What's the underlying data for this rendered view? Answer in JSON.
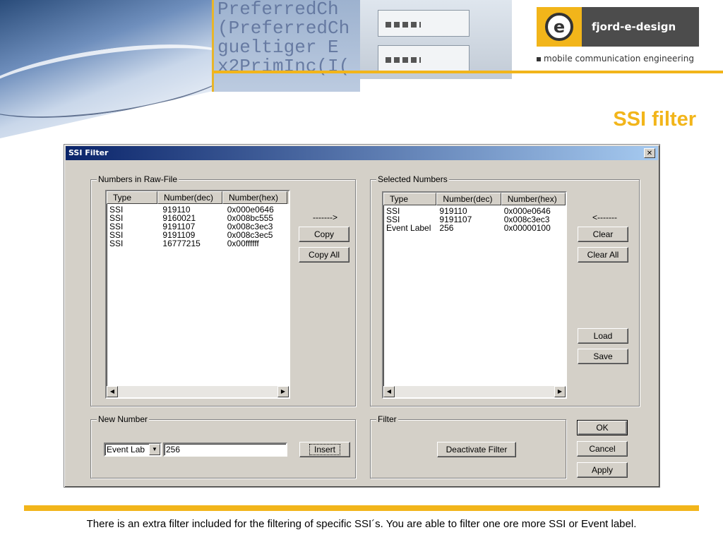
{
  "header": {
    "code_lines": [
      "PreferredCh",
      "(PreferredCh",
      " gueltiger E",
      "x2PrimInc(I("
    ],
    "logo_glyph": "e",
    "logo_text": "fjord-e-design",
    "tagline": "mobile communication engineering",
    "slide_title": "SSI filter",
    "accent_color": "#f2b51a"
  },
  "dialog": {
    "title": "SSI Filter",
    "close_glyph": "✕",
    "raw_group": {
      "label": "Numbers in Raw-File",
      "columns": [
        "Type",
        "Number(dec)",
        "Number(hex)"
      ],
      "rows": [
        [
          "SSI",
          "919110",
          "0x000e0646"
        ],
        [
          "SSI",
          "9160021",
          "0x008bc555"
        ],
        [
          "SSI",
          "9191107",
          "0x008c3ec3"
        ],
        [
          "SSI",
          "9191109",
          "0x008c3ec5"
        ],
        [
          "SSI",
          "16777215",
          "0x00ffffff"
        ]
      ]
    },
    "copy_arrow": "------->",
    "copy_label": "Copy",
    "copy_all_label": "Copy All",
    "selected_group": {
      "label": "Selected Numbers",
      "columns": [
        "Type",
        "Number(dec)",
        "Number(hex)"
      ],
      "rows": [
        [
          "SSI",
          "919110",
          "0x000e0646"
        ],
        [
          "SSI",
          "9191107",
          "0x008c3ec3"
        ],
        [
          "Event Label",
          "256",
          "0x00000100"
        ]
      ]
    },
    "clear_arrow": "<-------",
    "clear_label": "Clear",
    "clear_all_label": "Clear All",
    "load_label": "Load",
    "save_label": "Save",
    "new_number_group": {
      "label": "New Number",
      "type_value": "Event Lab",
      "number_value": "256",
      "insert_label": "Insert"
    },
    "filter_group": {
      "label": "Filter",
      "deactivate_label": "Deactivate Filter"
    },
    "ok_label": "OK",
    "cancel_label": "Cancel",
    "apply_label": "Apply",
    "scroll_left": "◀",
    "scroll_right": "▶",
    "dropdown_glyph": "▼"
  },
  "footer": {
    "text": "There is an extra filter included for the filtering of specific SSI´s. You are able to  filter one ore more SSI or Event label."
  }
}
